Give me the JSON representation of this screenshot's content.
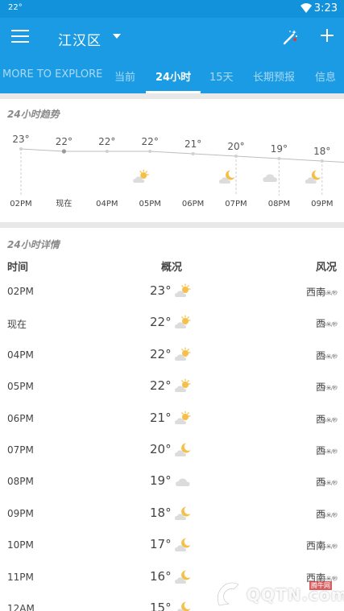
{
  "status_bar": {
    "temp": "22°",
    "time": "3:23"
  },
  "app_bar": {
    "city": "江汉区"
  },
  "tabs": [
    {
      "label": "MORE TO EXPLORE",
      "active": false
    },
    {
      "label": "当前",
      "active": false
    },
    {
      "label": "24小时",
      "active": true
    },
    {
      "label": "15天",
      "active": false
    },
    {
      "label": "长期预报",
      "active": false
    },
    {
      "label": "信息",
      "active": false
    }
  ],
  "trend": {
    "title": "24小时趋势",
    "chart_data": {
      "type": "line",
      "x": [
        "02PM",
        "现在",
        "04PM",
        "05PM",
        "06PM",
        "07PM",
        "08PM",
        "09PM"
      ],
      "values": [
        23,
        22,
        22,
        22,
        21,
        20,
        19,
        18
      ],
      "value_labels": [
        "23°",
        "22°",
        "22°",
        "22°",
        "21°",
        "20°",
        "19°",
        "18°"
      ],
      "icons": [
        "",
        "",
        "",
        "partly-cloudy-sun-icon",
        "",
        "cloud-moon-icon",
        "cloud-icon",
        "cloud-moon-icon"
      ]
    }
  },
  "details": {
    "title": "24小时详情",
    "headers": {
      "time": "时间",
      "summary": "概况",
      "wind": "风况"
    },
    "rows": [
      {
        "time": "02PM",
        "temp": "23°",
        "icon": "sun-cloud-icon",
        "dir": "西南",
        "speed": "1.6米/秒"
      },
      {
        "time": "现在",
        "temp": "22°",
        "icon": "sun-cloud-icon",
        "dir": "西",
        "speed": "1.0米/秒"
      },
      {
        "time": "04PM",
        "temp": "22°",
        "icon": "sun-cloud-icon",
        "dir": "西",
        "speed": "1.0米/秒"
      },
      {
        "time": "05PM",
        "temp": "22°",
        "icon": "sun-cloud-icon",
        "dir": "西",
        "speed": "0.7米/秒"
      },
      {
        "time": "06PM",
        "temp": "21°",
        "icon": "sun-cloud-icon",
        "dir": "西",
        "speed": "0.6米/秒"
      },
      {
        "time": "07PM",
        "temp": "20°",
        "icon": "moon-cloud-icon",
        "dir": "西",
        "speed": "0.5米/秒"
      },
      {
        "time": "08PM",
        "temp": "19°",
        "icon": "cloud-icon",
        "dir": "西",
        "speed": "0.4米/秒"
      },
      {
        "time": "09PM",
        "temp": "18°",
        "icon": "moon-cloud-icon",
        "dir": "西",
        "speed": "0.5米/秒"
      },
      {
        "time": "10PM",
        "temp": "17°",
        "icon": "moon-cloud-icon",
        "dir": "西南",
        "speed": "0.5米/秒"
      },
      {
        "time": "11PM",
        "temp": "16°",
        "icon": "moon-cloud-icon",
        "dir": "西南",
        "speed": "0.6米/秒"
      },
      {
        "time": "12AM",
        "temp": "15°",
        "icon": "moon-cloud-icon",
        "dir": "",
        "speed": ""
      }
    ]
  },
  "watermark": {
    "text": "QQTN.com",
    "sub": "腾牛网"
  },
  "colors": {
    "appbar": "#1a9be3",
    "statusbar": "#1192db",
    "sun": "#f5c04a",
    "cloud": "#dcdcdc"
  }
}
